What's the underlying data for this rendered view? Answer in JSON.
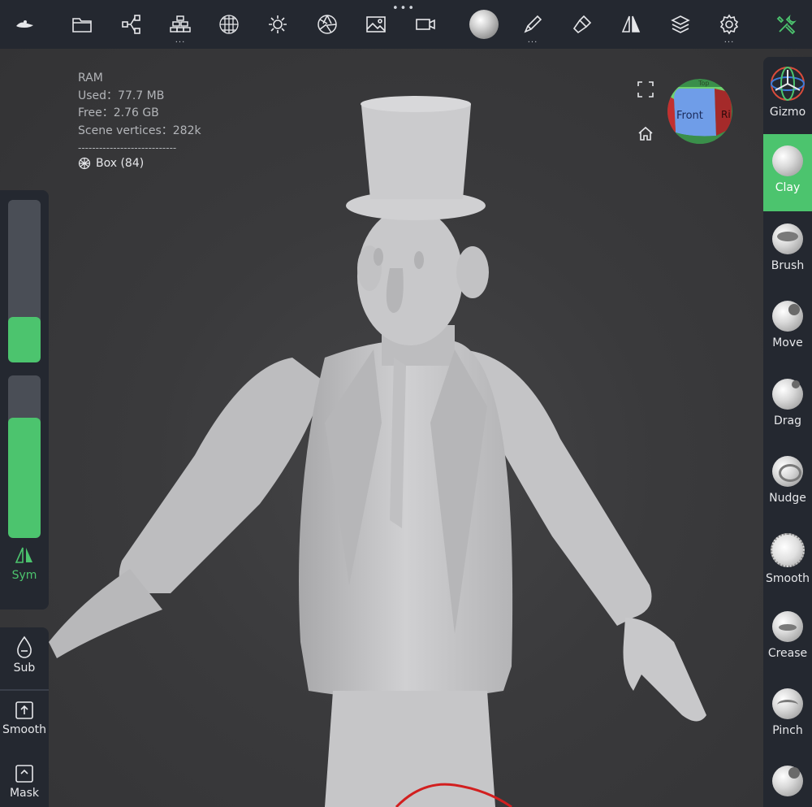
{
  "toolbar": {
    "icons": [
      "app-logo-icon",
      "folder-icon",
      "share-nodes-icon",
      "layers-stack-icon",
      "grid-sphere-icon",
      "sun-icon",
      "aperture-icon",
      "image-icon",
      "video-camera-icon",
      "material-sphere-icon",
      "pen-icon",
      "paint-brush-icon",
      "symmetry-icon",
      "stack-icon",
      "gear-icon",
      "tools-icon"
    ],
    "more_dots": "•••",
    "sub_dots": "..."
  },
  "stats": {
    "ram_label": "RAM",
    "used": "Used：77.7 MB",
    "free": "Free：2.76 GB",
    "vertices": "Scene vertices：282k",
    "separator": "----------------------------",
    "object": "Box (84)"
  },
  "viewcube": {
    "front_label": "Front",
    "right_label": "Ri",
    "top_label": "Top"
  },
  "left_panel": {
    "size_slider_value": 0.28,
    "intensity_slider_value": 0.74,
    "sym_label": "Sym",
    "sub_label": "Sub",
    "smooth_label": "Smooth",
    "mask_label": "Mask"
  },
  "right_panel": {
    "tools": [
      {
        "label": "Gizmo"
      },
      {
        "label": "Clay"
      },
      {
        "label": "Brush"
      },
      {
        "label": "Move"
      },
      {
        "label": "Drag"
      },
      {
        "label": "Nudge"
      },
      {
        "label": "Smooth"
      },
      {
        "label": "Crease"
      },
      {
        "label": "Pinch"
      }
    ],
    "active_tool": "Clay"
  },
  "colors": {
    "accent": "#4cc46e",
    "panel_bg": "#242830",
    "viewport_bg": "#3a3a3c",
    "model": "#c8c8ca"
  }
}
